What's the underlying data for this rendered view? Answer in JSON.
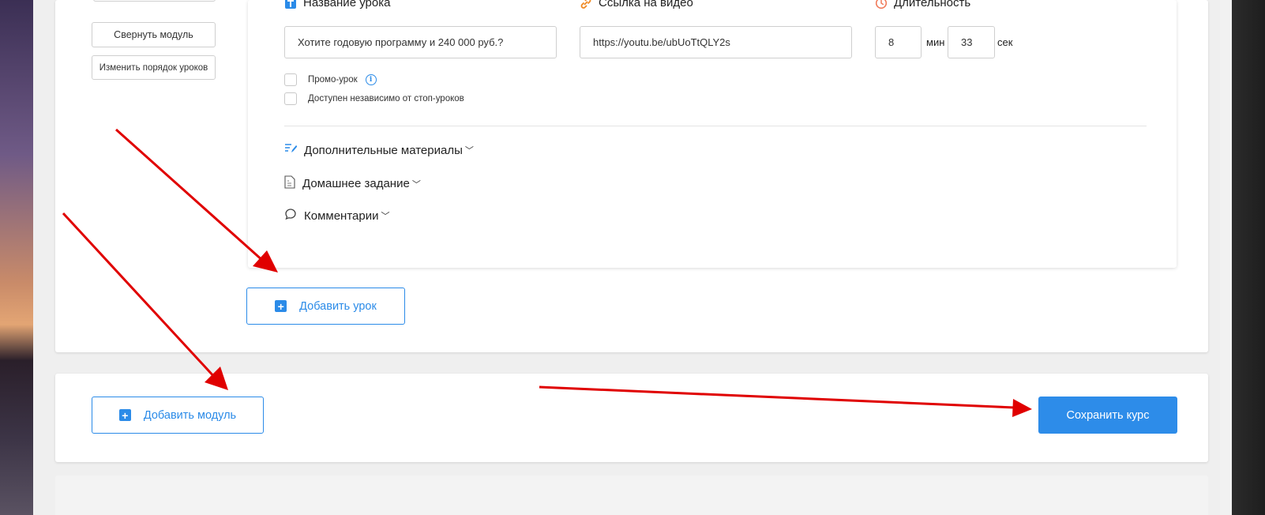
{
  "sidebar": {
    "collapse_module": "Свернуть модуль",
    "reorder_lessons": "Изменить порядок уроков"
  },
  "lesson": {
    "title_label": "Название урока",
    "title_value": "Хотите годовую программу и 240 000 руб.?",
    "video_label": "Ссылка на видео",
    "video_value": "https://youtu.be/ubUoTtQLY2s",
    "duration_label": "Длительность",
    "duration_min": "8",
    "min_unit": "мин",
    "duration_sec": "33",
    "sec_unit": "сек",
    "promo_label": "Промо-урок",
    "independent_label": "Доступен независимо от стоп-уроков",
    "sections": {
      "materials": "Дополнительные материалы",
      "homework": "Домашнее задание",
      "comments": "Комментарии"
    }
  },
  "actions": {
    "add_lesson": "Добавить урок",
    "add_module": "Добавить модуль",
    "save_course": "Сохранить курс"
  },
  "colors": {
    "accent": "#2b8be8",
    "annotation_arrow": "#e00000"
  },
  "icons": {
    "title": "text-t-icon",
    "video": "link-icon",
    "duration": "clock-icon",
    "info": "info-icon",
    "materials": "pencil-list-icon",
    "homework": "document-icon",
    "comments": "speech-bubble-icon",
    "add": "plus-square-icon"
  }
}
